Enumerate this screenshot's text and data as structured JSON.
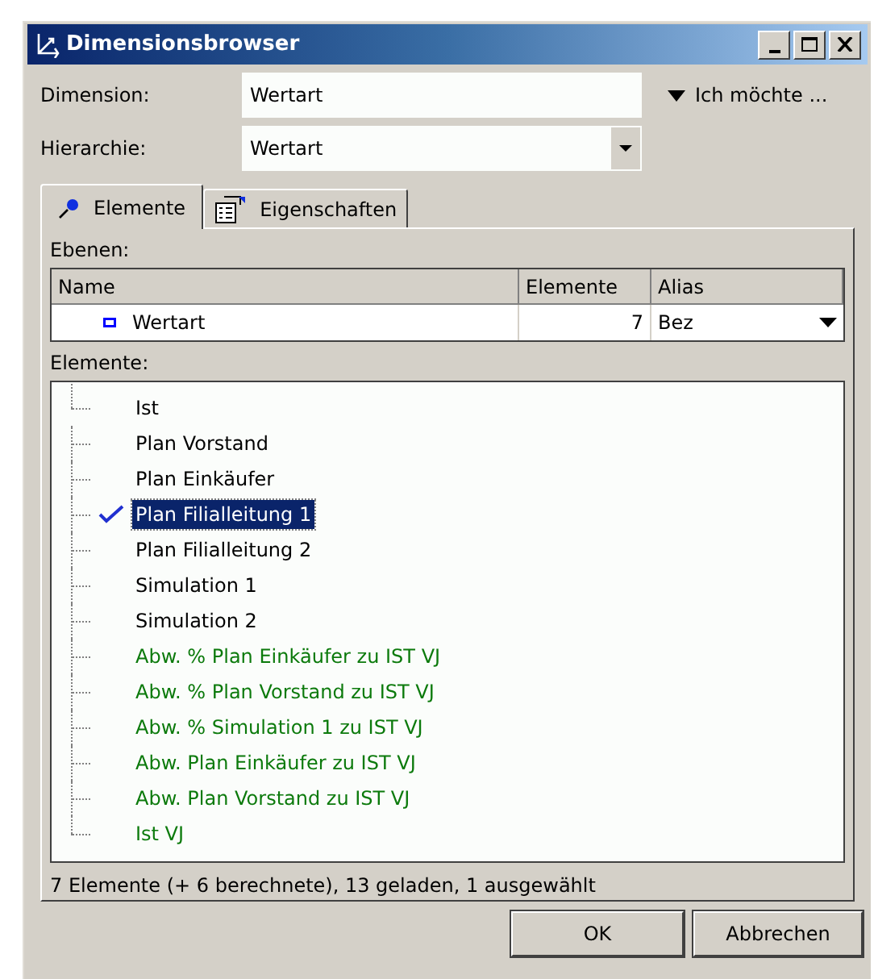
{
  "window": {
    "title": "Dimensionsbrowser"
  },
  "fields": [
    {
      "label": "Dimension:",
      "value": "Wertart",
      "kind": "text"
    },
    {
      "label": "Hierarchie:",
      "value": "Wertart",
      "kind": "dropdown"
    }
  ],
  "menu_link": "Ich möchte ...",
  "tabs": [
    {
      "label": "Elemente",
      "selected": true,
      "kind": "pin"
    },
    {
      "label": "Eigenschaften",
      "selected": false,
      "kind": "sheet"
    }
  ],
  "levels": {
    "label": "Ebenen:",
    "columns": [
      "Name",
      "Elemente",
      "Alias"
    ],
    "rows": [
      {
        "name": "Wertart",
        "count": "7",
        "alias": "Bez"
      }
    ]
  },
  "elements": {
    "label": "Elemente:",
    "items": [
      {
        "label": "Ist",
        "kind": "base",
        "selected": false
      },
      {
        "label": "Plan Vorstand",
        "kind": "base",
        "selected": false
      },
      {
        "label": "Plan Einkäufer",
        "kind": "base",
        "selected": false
      },
      {
        "label": "Plan Filialleitung 1",
        "kind": "base",
        "selected": true
      },
      {
        "label": "Plan Filialleitung 2",
        "kind": "base",
        "selected": false
      },
      {
        "label": "Simulation 1",
        "kind": "base",
        "selected": false
      },
      {
        "label": "Simulation 2",
        "kind": "base",
        "selected": false
      },
      {
        "label": "Abw. % Plan Einkäufer zu IST VJ",
        "kind": "computed",
        "selected": false
      },
      {
        "label": "Abw. % Plan Vorstand zu IST VJ",
        "kind": "computed",
        "selected": false
      },
      {
        "label": "Abw. % Simulation 1 zu IST VJ",
        "kind": "computed",
        "selected": false
      },
      {
        "label": "Abw. Plan Einkäufer zu IST VJ",
        "kind": "computed",
        "selected": false
      },
      {
        "label": "Abw. Plan Vorstand zu IST VJ",
        "kind": "computed",
        "selected": false
      },
      {
        "label": "Ist VJ",
        "kind": "computed",
        "selected": false
      }
    ]
  },
  "status_bar": "7 Elemente (+ 6 berechnete), 13 geladen, 1 ausgewählt",
  "buttons": [
    "OK",
    "Abbrechen"
  ]
}
